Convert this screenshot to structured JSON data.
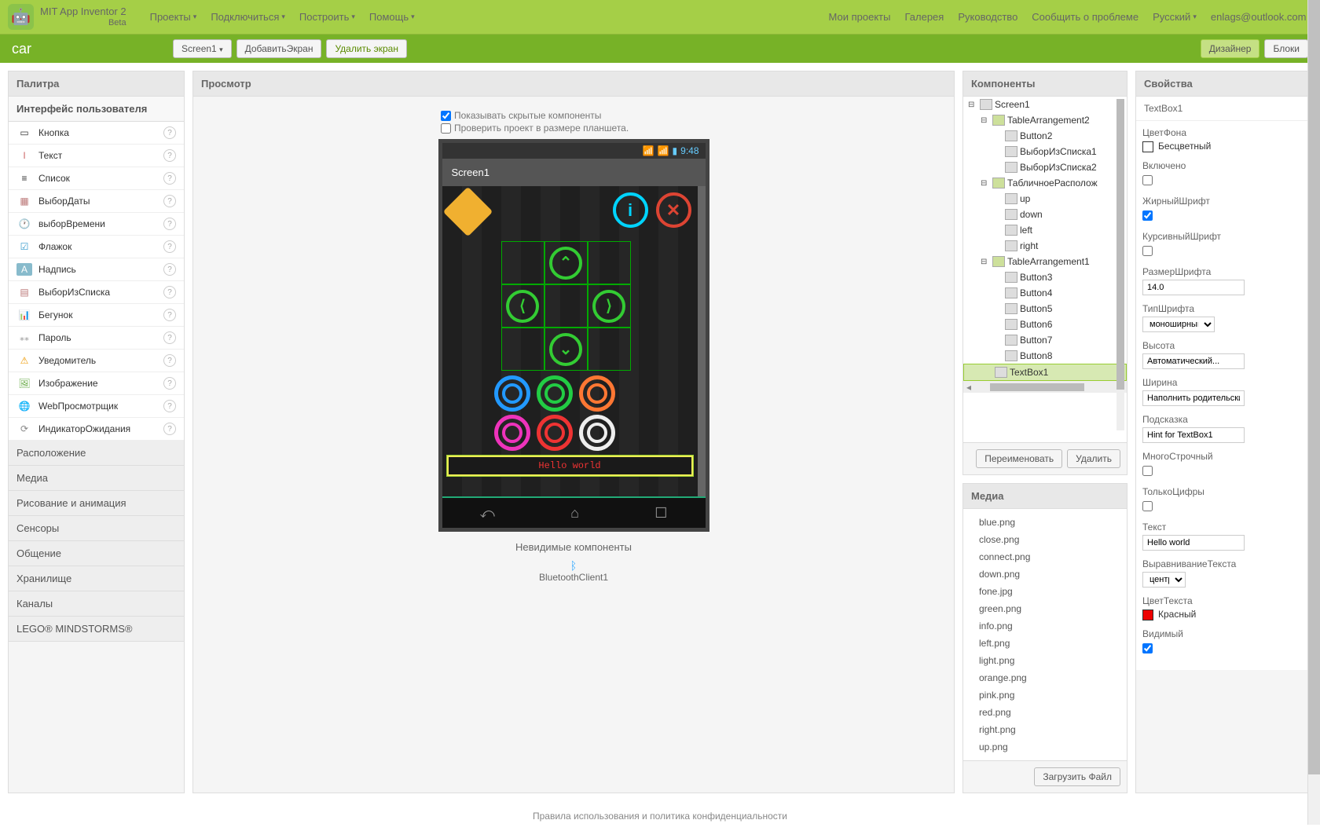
{
  "app": {
    "title": "MIT App Inventor 2",
    "beta": "Beta"
  },
  "menu": {
    "projects": "Проекты",
    "connect": "Подключиться",
    "build": "Построить",
    "help": "Помощь"
  },
  "menuRight": {
    "myProjects": "Мои проекты",
    "gallery": "Галерея",
    "guide": "Руководство",
    "report": "Сообщить о проблеме",
    "lang": "Русский",
    "email": "enlags@outlook.com"
  },
  "project": {
    "name": "car",
    "screen": "Screen1",
    "addScreen": "ДобавитьЭкран",
    "removeScreen": "Удалить экран",
    "designer": "Дизайнер",
    "blocks": "Блоки"
  },
  "panels": {
    "palette": "Палитра",
    "viewer": "Просмотр",
    "components": "Компоненты",
    "properties": "Свойства",
    "media": "Медиа"
  },
  "palette": {
    "sections": {
      "ui": "Интерфейс пользователя",
      "layout": "Расположение",
      "media": "Медиа",
      "drawing": "Рисование и анимация",
      "sensors": "Сенсоры",
      "social": "Общение",
      "storage": "Хранилище",
      "channels": "Каналы",
      "lego": "LEGO® MINDSTORMS®"
    },
    "items": [
      "Кнопка",
      "Текст",
      "Список",
      "ВыборДаты",
      "выборВремени",
      "Флажок",
      "Надпись",
      "ВыборИзСписка",
      "Бегунок",
      "Пароль",
      "Уведомитель",
      "Изображение",
      "WebПросмотрщик",
      "ИндикаторОжидания"
    ]
  },
  "viewer": {
    "showHidden": "Показывать скрытые компоненты",
    "tabletSize": "Проверить проект в размере планшета.",
    "time": "9:48",
    "screenTitle": "Screen1",
    "textboxValue": "Hello world",
    "invisible": "Невидимые компоненты",
    "btClient": "BluetoothClient1"
  },
  "tree": {
    "root": "Screen1",
    "ta2": "TableArrangement2",
    "ta2_children": [
      "Button2",
      "ВыборИзСписка1",
      "ВыборИзСписка2"
    ],
    "tab": "ТабличноеРасполож",
    "tab_children": [
      "up",
      "down",
      "left",
      "right"
    ],
    "ta1": "TableArrangement1",
    "ta1_children": [
      "Button3",
      "Button4",
      "Button5",
      "Button6",
      "Button7",
      "Button8"
    ],
    "selected": "TextBox1",
    "rename": "Переименовать",
    "delete": "Удалить"
  },
  "media": {
    "files": [
      "blue.png",
      "close.png",
      "connect.png",
      "down.png",
      "fone.jpg",
      "green.png",
      "info.png",
      "left.png",
      "light.png",
      "orange.png",
      "pink.png",
      "red.png",
      "right.png",
      "up.png"
    ],
    "upload": "Загрузить Файл"
  },
  "props": {
    "component": "TextBox1",
    "bgColor": {
      "label": "ЦветФона",
      "value": "Бесцветный"
    },
    "enabled": "Включено",
    "bold": "ЖирныйШрифт",
    "italic": "КурсивныйШрифт",
    "fontSize": {
      "label": "РазмерШрифта",
      "value": "14.0"
    },
    "fontType": {
      "label": "ТипШрифта",
      "value": "моноширный"
    },
    "height": {
      "label": "Высота",
      "value": "Автоматический..."
    },
    "width": {
      "label": "Ширина",
      "value": "Наполнить родительский"
    },
    "hint": {
      "label": "Подсказка",
      "value": "Hint for TextBox1"
    },
    "multiline": "МногоСтрочный",
    "numOnly": "ТолькоЦифры",
    "text": {
      "label": "Текст",
      "value": "Hello world"
    },
    "align": {
      "label": "ВыравниваниеТекста",
      "value": "центр"
    },
    "textColor": {
      "label": "ЦветТекста",
      "value": "Красный"
    },
    "visible": "Видимый"
  },
  "footer": "Правила использования и политика конфиденциальности"
}
